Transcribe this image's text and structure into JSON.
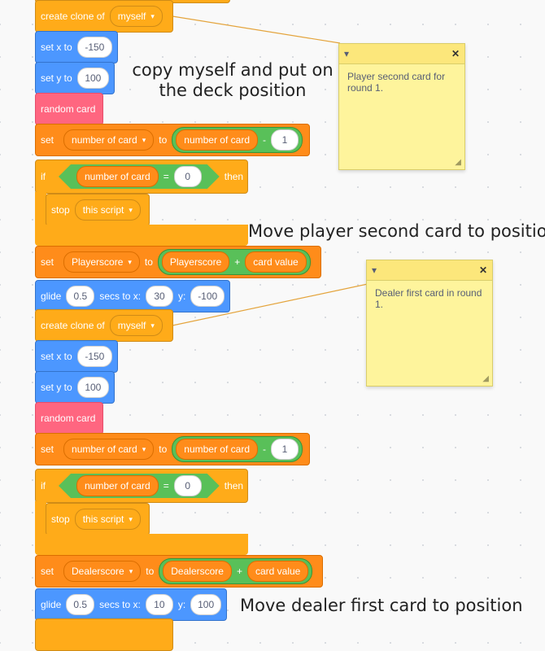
{
  "blocks": {
    "create_clone_1": {
      "label": "create clone of",
      "target": "myself"
    },
    "set_x_1": {
      "label": "set x to",
      "value": "-150"
    },
    "set_y_1": {
      "label": "set y to",
      "value": "100"
    },
    "random_card_1": {
      "label": "random card"
    },
    "set_var_1": {
      "label": "set",
      "var": "number of card",
      "to": "to",
      "reporter": "number of card",
      "op": "-",
      "value": "1"
    },
    "if_1": {
      "label": "if",
      "reporter": "number of card",
      "op": "=",
      "value": "0",
      "then": "then"
    },
    "stop_1": {
      "label": "stop",
      "option": "this script"
    },
    "set_score_1": {
      "label": "set",
      "var": "Playerscore",
      "to": "to",
      "reporter": "Playerscore",
      "op": "+",
      "value": "card value"
    },
    "glide_1": {
      "label": "glide",
      "secs": "0.5",
      "secs_label": "secs to x:",
      "x": "30",
      "y_label": "y:",
      "y": "-100"
    },
    "create_clone_2": {
      "label": "create clone of",
      "target": "myself"
    },
    "set_x_2": {
      "label": "set x to",
      "value": "-150"
    },
    "set_y_2": {
      "label": "set y to",
      "value": "100"
    },
    "random_card_2": {
      "label": "random card"
    },
    "set_var_2": {
      "label": "set",
      "var": "number of card",
      "to": "to",
      "reporter": "number of card",
      "op": "-",
      "value": "1"
    },
    "if_2": {
      "label": "if",
      "reporter": "number of card",
      "op": "=",
      "value": "0",
      "then": "then"
    },
    "stop_2": {
      "label": "stop",
      "option": "this script"
    },
    "set_score_2": {
      "label": "set",
      "var": "Dealerscore",
      "to": "to",
      "reporter": "Dealerscore",
      "op": "+",
      "value": "card value"
    },
    "glide_2": {
      "label": "glide",
      "secs": "0.5",
      "secs_label": "secs to x:",
      "x": "10",
      "y_label": "y:",
      "y": "100"
    }
  },
  "comments": {
    "c1": "copy myself and put on the deck position",
    "c2": "Move player second card to position",
    "c3": "Move dealer first card to position"
  },
  "notes": {
    "n1": "Player second card for round 1.",
    "n2": "Dealer first card in round 1."
  },
  "icons": {
    "collapse": "▾",
    "close": "✕",
    "dropdown": "▾",
    "resize": "◢"
  },
  "colors": {
    "control": "#ffab19",
    "motion": "#4c97ff",
    "looks": "#ff6680",
    "variables": "#ff8c1a",
    "operators": "#59c059",
    "note": "#fef49c"
  }
}
